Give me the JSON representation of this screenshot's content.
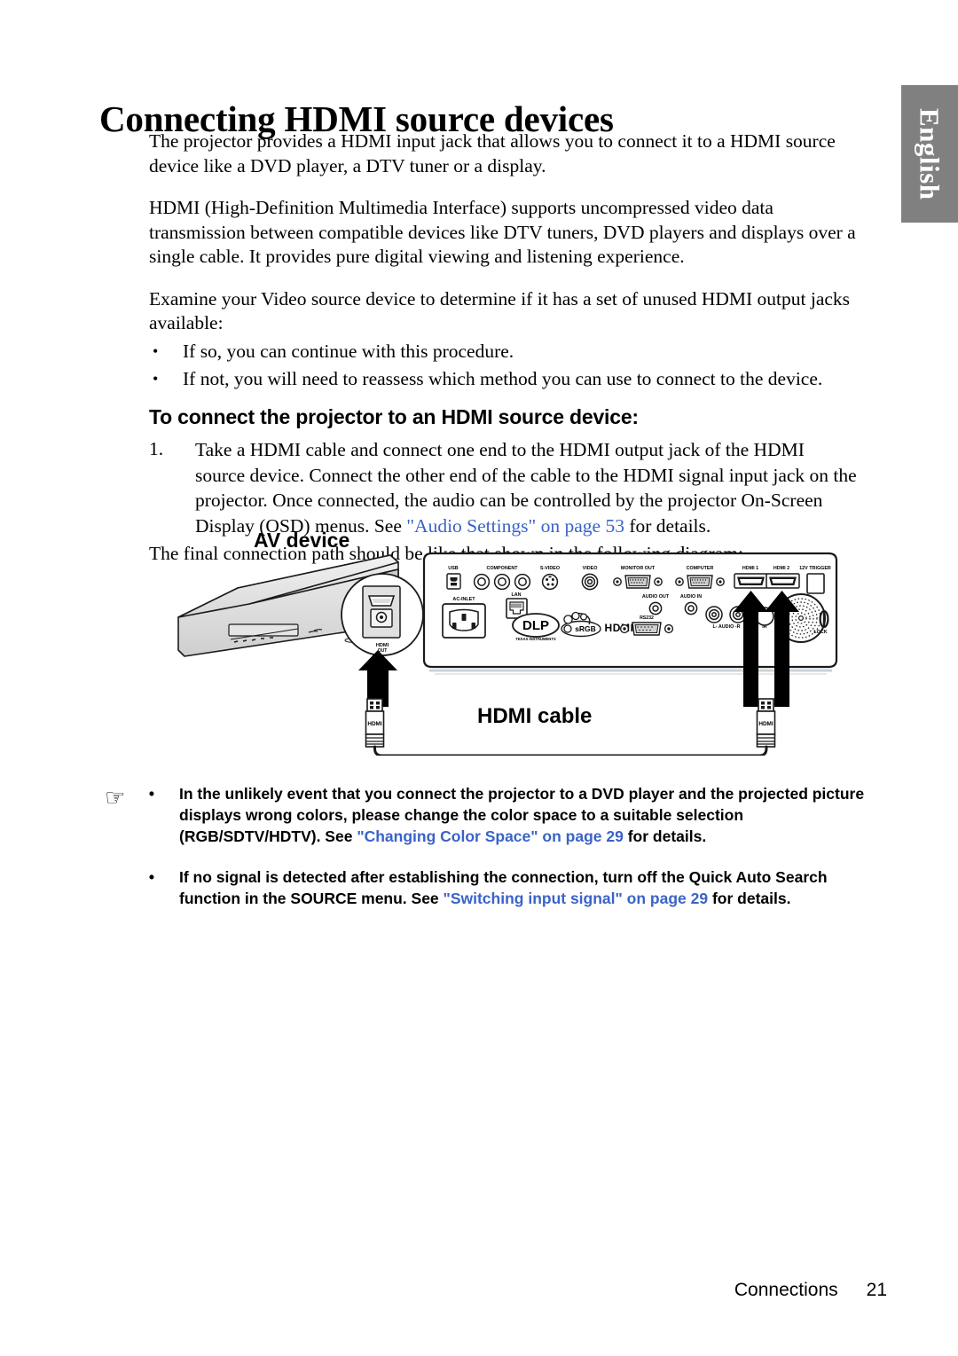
{
  "language_tab": {
    "label": "English",
    "background": "#808080",
    "text_color": "#ffffff"
  },
  "page_title": "Connecting HDMI source devices",
  "body": {
    "paragraph_1": "The projector provides a HDMI input jack that allows you to connect it to a HDMI source device like a DVD player, a DTV tuner or a display.",
    "paragraph_2": "HDMI (High-Definition Multimedia Interface) supports uncompressed video data transmission between compatible devices like DTV tuners, DVD players and displays over a single cable. It provides pure digital viewing and listening experience.",
    "paragraph_3": "Examine your Video source device to determine if it has a set of unused HDMI output jacks available:",
    "bullets": [
      {
        "marker": "•",
        "text": "If so, you can continue with this procedure."
      },
      {
        "marker": "•",
        "text": "If not, you will need to reassess which method you can use to connect to the device."
      }
    ],
    "sub_heading": "To connect the projector to an HDMI source device:",
    "steps": [
      {
        "number": "1.",
        "text_before": "Take a HDMI cable and connect one end to the HDMI output jack of the HDMI source device. Connect the other end of the cable to the HDMI signal input jack on the projector. Once connected, the audio can be controlled by the projector On-Screen Display (OSD) menus. See ",
        "cross_reference": "\"Audio Settings\" on page 53",
        "text_after": " for details."
      }
    ],
    "closing_line": "The final connection path should be like that shown in the following diagram:"
  },
  "diagram": {
    "av_device_label": "AV device",
    "hdmi_cable_label": "HDMI cable",
    "av_device_port_label": "HDMI OUT",
    "connector_label": "HDMI",
    "projector_panel": {
      "top_row_labels": [
        "USB",
        "COMPONENT",
        "S-VIDEO",
        "VIDEO",
        "MONITOR OUT",
        "COMPUTER",
        "HDMI 1",
        "HDMI 2",
        "12V TRIGGER"
      ],
      "bottom_row_labels": [
        "AC-INLET",
        "LAN",
        "AUDIO OUT",
        "AUDIO IN",
        "RS232",
        "L- AUDIO -R",
        "IR",
        "LOCK"
      ],
      "logos": [
        "DLP",
        "TEXAS INSTRUMENTS",
        "BrilliantColor",
        "sRGB",
        "HDMI"
      ],
      "highlighted_ports": [
        "HDMI 1",
        "HDMI 2"
      ]
    }
  },
  "notes": {
    "icon": "pointing-hand",
    "items": [
      {
        "marker": "•",
        "text_before": "In the unlikely event that you connect the projector to a DVD player and the projected picture displays wrong colors, please change the color space to a suitable selection (RGB/SDTV/HDTV). See ",
        "cross_reference": "\"Changing Color Space\" on page 29",
        "text_after": " for details."
      },
      {
        "marker": "•",
        "text_before": "If no signal is detected after establishing the connection, turn off the Quick Auto Search function in the SOURCE menu. See ",
        "cross_reference": "\"Switching input signal\" on page 29",
        "text_after": " for details."
      }
    ]
  },
  "footer": {
    "section": "Connections",
    "page_number": "21"
  },
  "colors": {
    "cross_reference": "#3a63c8",
    "tab_gray": "#808080",
    "ink": "#000000"
  }
}
